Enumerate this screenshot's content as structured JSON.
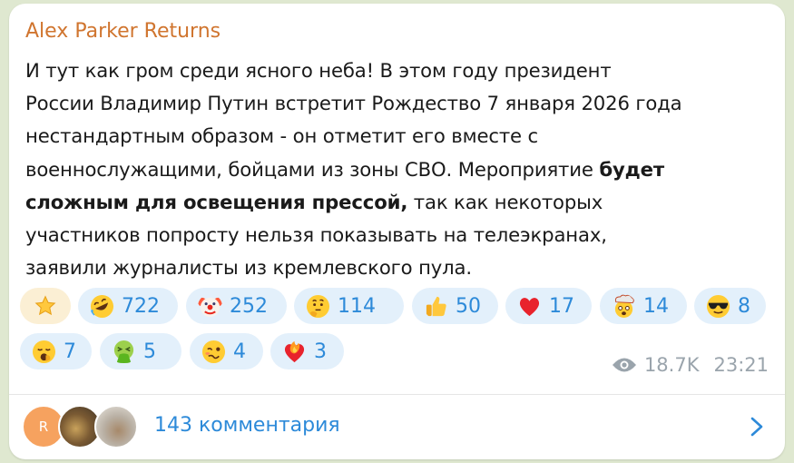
{
  "post": {
    "author": "Alex Parker Returns",
    "lines": [
      [
        "И тут как гром среди ясного неба! В этом году президент"
      ],
      [
        "России Владимир Путин встретит Рождество 7 января 2026 года"
      ],
      [
        "нестандартным образом - он отметит его вместе с"
      ],
      [
        "военнослужащими, бойцами из зоны СВО. Мероприятие ",
        "будет"
      ],
      [
        "",
        "сложным для освещения прессой,",
        " так как некоторых"
      ],
      [
        "участников попросту нельзя показывать на телеэкранах,"
      ],
      [
        "заявили журналисты из кремлевского пула."
      ]
    ],
    "line1": "И тут как гром среди ясного неба! В этом году президент",
    "line2": "России Владимир Путин встретит Рождество 7 января 2026 года",
    "line3": "нестандартным образом - он отметит его вместе с",
    "line4_a": "военнослужащими, бойцами из зоны СВО. Мероприятие ",
    "line4_b": "будет",
    "line5_b": "сложным для освещения прессой,",
    "line5_c": " так как некоторых",
    "line6": "участников попросту нельзя показывать на телеэкранах,",
    "line7": "заявили журналисты из кремлевского пула."
  },
  "reactions": [
    {
      "icon": "star-icon",
      "count": ""
    },
    {
      "icon": "rofl-icon",
      "count": "722"
    },
    {
      "icon": "clown-icon",
      "count": "252"
    },
    {
      "icon": "thinking-icon",
      "count": "114"
    },
    {
      "icon": "thumbs-up-icon",
      "count": "50"
    },
    {
      "icon": "heart-icon",
      "count": "17"
    },
    {
      "icon": "exploding-head-icon",
      "count": "14"
    },
    {
      "icon": "sunglasses-icon",
      "count": "8"
    },
    {
      "icon": "yawning-icon",
      "count": "7"
    },
    {
      "icon": "vomiting-icon",
      "count": "5"
    },
    {
      "icon": "woozy-icon",
      "count": "4"
    },
    {
      "icon": "heart-on-fire-icon",
      "count": "3"
    }
  ],
  "meta": {
    "views": "18.7K",
    "time": "23:21"
  },
  "comments": {
    "avatar_letter": "R",
    "label": "143 комментария"
  },
  "colors": {
    "author": "#d0752f",
    "accent": "#2d8ad9",
    "reaction_bg": "#e3f0fb",
    "bubble": "#ffffff",
    "background": "#dfe8d0"
  }
}
